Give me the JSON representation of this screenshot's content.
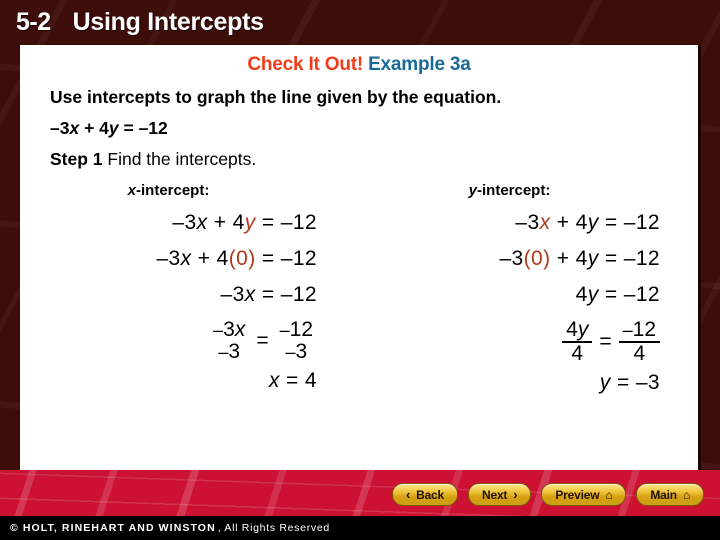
{
  "slide": {
    "lesson_number": "5-2",
    "lesson_title": "Using Intercepts"
  },
  "example": {
    "label_primary": "Check It Out!",
    "label_secondary": "Example 3a",
    "color_primary": "#f03c18",
    "color_secondary": "#1a6a96"
  },
  "body": {
    "prompt": "Use intercepts to graph the line given by the equation.",
    "equation_prefix": "–3",
    "equation_x_var": "x",
    "equation_middle": " + 4",
    "equation_y_var": "y",
    "equation_suffix": " = –12",
    "step_bold": "Step 1",
    "step_rest": "Find the intercepts."
  },
  "x_intercept": {
    "label_var": "x",
    "label_rest": "-intercept:",
    "lines": [
      {
        "id": "line1",
        "parts": [
          {
            "t": "–3",
            "style": "plain"
          },
          {
            "t": "x",
            "style": "italic"
          },
          {
            "t": " + 4",
            "style": "plain"
          },
          {
            "t": "y",
            "style": "italic-hl"
          },
          {
            "t": " = –12",
            "style": "plain"
          }
        ]
      },
      {
        "id": "line2",
        "parts": [
          {
            "t": "–3",
            "style": "plain"
          },
          {
            "t": "x",
            "style": "italic"
          },
          {
            "t": " + 4",
            "style": "plain"
          },
          {
            "t": "(0)",
            "style": "hl"
          },
          {
            "t": " = –12",
            "style": "plain"
          }
        ]
      },
      {
        "id": "line3",
        "parts": [
          {
            "t": "–3",
            "style": "plain"
          },
          {
            "t": "x",
            "style": "italic"
          },
          {
            "t": "  = –12",
            "style": "plain"
          }
        ]
      },
      {
        "id": "line5",
        "parts": [
          {
            "t": "x",
            "style": "italic"
          },
          {
            "t": " = 4",
            "style": "plain"
          }
        ]
      }
    ],
    "fraction": {
      "ruled": false,
      "left_num_neg": "–",
      "left_num": "3",
      "left_num_var": "x",
      "left_den_neg": "–",
      "left_den": "3",
      "equals": "=",
      "right_num_neg": "–",
      "right_num": "12",
      "right_den_neg": "–",
      "right_den": "3"
    }
  },
  "y_intercept": {
    "label_var": "y",
    "label_rest": "-intercept:",
    "lines": [
      {
        "id": "line1",
        "parts": [
          {
            "t": "–3",
            "style": "plain"
          },
          {
            "t": "x",
            "style": "italic-hl"
          },
          {
            "t": " + 4",
            "style": "plain"
          },
          {
            "t": "y",
            "style": "italic"
          },
          {
            "t": " = –12",
            "style": "plain"
          }
        ]
      },
      {
        "id": "line2",
        "parts": [
          {
            "t": "–3",
            "style": "plain"
          },
          {
            "t": "(0)",
            "style": "hl"
          },
          {
            "t": " + 4",
            "style": "plain"
          },
          {
            "t": "y",
            "style": "italic"
          },
          {
            "t": " = –12",
            "style": "plain"
          }
        ]
      },
      {
        "id": "line3",
        "parts": [
          {
            "t": "4",
            "style": "plain"
          },
          {
            "t": "y",
            "style": "italic"
          },
          {
            "t": "  = –12",
            "style": "plain"
          }
        ]
      },
      {
        "id": "line5",
        "parts": [
          {
            "t": "y",
            "style": "italic"
          },
          {
            "t": " = –3",
            "style": "plain"
          }
        ]
      }
    ],
    "fraction": {
      "ruled": true,
      "left_num_neg": "",
      "left_num": "4",
      "left_num_var": "y",
      "left_den_neg": "",
      "left_den": "4",
      "equals": "=",
      "right_num_neg": "–",
      "right_num": "12",
      "right_den_neg": "",
      "right_den": "4"
    }
  },
  "nav": {
    "buttons": [
      {
        "label": "Back",
        "icon": "chevron-left-icon",
        "glyph": "‹",
        "icon_side": "left"
      },
      {
        "label": "Next",
        "icon": "chevron-right-icon",
        "glyph": "›",
        "icon_side": "right"
      },
      {
        "label": "Preview",
        "icon": "home-icon",
        "glyph": "⌂",
        "icon_side": "right"
      },
      {
        "label": "Main",
        "icon": "home-icon",
        "glyph": "⌂",
        "icon_side": "right"
      }
    ]
  },
  "footer": {
    "strong": "© HOLT, RINEHART AND WINSTON",
    "rest": ", All Rights Reserved"
  }
}
